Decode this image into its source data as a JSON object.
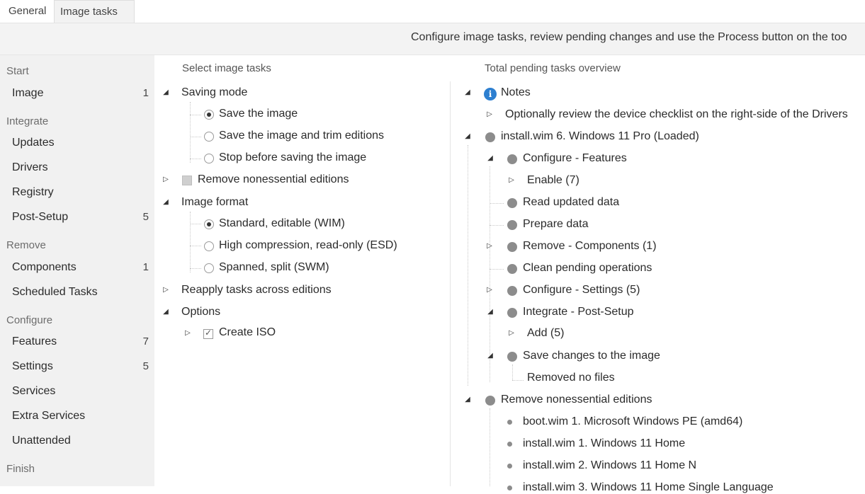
{
  "tabs": [
    {
      "label": "General"
    },
    {
      "label": "Image tasks"
    }
  ],
  "info_text": "Configure image tasks, review pending changes and use the Process button on the too",
  "sidebar": {
    "sections": [
      {
        "heading": "Start",
        "items": [
          {
            "label": "Image",
            "count": "1"
          }
        ]
      },
      {
        "heading": "Integrate",
        "items": [
          {
            "label": "Updates",
            "count": ""
          },
          {
            "label": "Drivers",
            "count": ""
          },
          {
            "label": "Registry",
            "count": ""
          },
          {
            "label": "Post-Setup",
            "count": "5"
          }
        ]
      },
      {
        "heading": "Remove",
        "items": [
          {
            "label": "Components",
            "count": "1"
          },
          {
            "label": "Scheduled Tasks",
            "count": ""
          }
        ]
      },
      {
        "heading": "Configure",
        "items": [
          {
            "label": "Features",
            "count": "7"
          },
          {
            "label": "Settings",
            "count": "5"
          },
          {
            "label": "Services",
            "count": ""
          },
          {
            "label": "Extra Services",
            "count": ""
          },
          {
            "label": "Unattended",
            "count": ""
          }
        ]
      },
      {
        "heading": "Finish",
        "items": []
      }
    ]
  },
  "mid": {
    "header": "Select image tasks",
    "saving_mode": "Saving mode",
    "save_image": "Save the image",
    "save_trim": "Save the image and trim editions",
    "stop_before": "Stop before saving the image",
    "remove_nonessential": "Remove nonessential editions",
    "image_format": "Image format",
    "fmt_wim": "Standard, editable (WIM)",
    "fmt_esd": "High compression, read-only (ESD)",
    "fmt_swm": "Spanned, split (SWM)",
    "reapply": "Reapply tasks across editions",
    "options": "Options",
    "create_iso": "Create ISO"
  },
  "right": {
    "header": "Total pending tasks overview",
    "notes": "Notes",
    "notes_child": "Optionally review the device checklist on the right-side of the Drivers",
    "install_wim": "install.wim 6. Windows 11 Pro  (Loaded)",
    "cfg_features": "Configure - Features",
    "enable": "Enable (7)",
    "read_updated": "Read updated data",
    "prepare_data": "Prepare data",
    "remove_components": "Remove - Components (1)",
    "clean_pending": "Clean pending operations",
    "cfg_settings": "Configure - Settings (5)",
    "integrate_post": "Integrate - Post-Setup",
    "add": "Add (5)",
    "save_changes": "Save changes to the image",
    "removed_no_files": "Removed no files",
    "remove_nonessential": "Remove nonessential editions",
    "editions": [
      "boot.wim 1. Microsoft Windows PE (amd64)",
      "install.wim 1. Windows 11 Home",
      "install.wim 2. Windows 11 Home N",
      "install.wim 3. Windows 11 Home Single Language"
    ]
  },
  "colors": {
    "info_icon": "#2d7fd0",
    "status_dot": "#8c8c8c",
    "sidebar_bg": "#f1f1f1"
  }
}
